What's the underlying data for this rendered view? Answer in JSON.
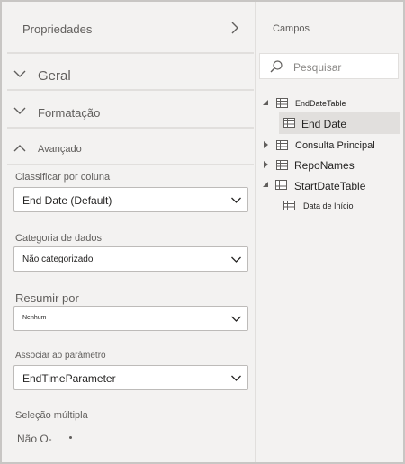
{
  "properties": {
    "title": "Propriedades",
    "sections": {
      "geral": "Geral",
      "formatacao": "Formatação",
      "avancado": "Avançado"
    },
    "fields": {
      "sort_by": {
        "label": "Classificar por coluna",
        "value": "End Date (Default)"
      },
      "data_category": {
        "label": "Categoria de dados",
        "value": "Não categorizado"
      },
      "summarize_by": {
        "label": "Resumir por",
        "value": "Nenhum"
      },
      "bind_to_parameter": {
        "label": "Associar ao parâmetro",
        "value": "EndTimeParameter"
      },
      "multi_select": {
        "label": "Seleção múltipla",
        "value": "Não O-"
      }
    }
  },
  "fields_pane": {
    "title": "Campos",
    "search_placeholder": "Pesquisar",
    "tables": [
      {
        "name": "EndDateTable",
        "expanded": true,
        "columns": [
          "End Date"
        ]
      },
      {
        "name": "Consulta Principal",
        "expanded": false
      },
      {
        "name": "RepoNames",
        "expanded": false
      },
      {
        "name": "StartDateTable",
        "expanded": true,
        "columns": [
          "Data de Início"
        ]
      }
    ]
  },
  "icons": {
    "expand": "chevron-right-icon",
    "collapse": "chevron-down-icon",
    "collapsed_up": "chevron-up-icon",
    "search": "search-icon",
    "table": "table-icon"
  },
  "colors": {
    "background": "#f3f2f1",
    "selected": "#e1dfdd",
    "border": "#c8c6c4"
  }
}
